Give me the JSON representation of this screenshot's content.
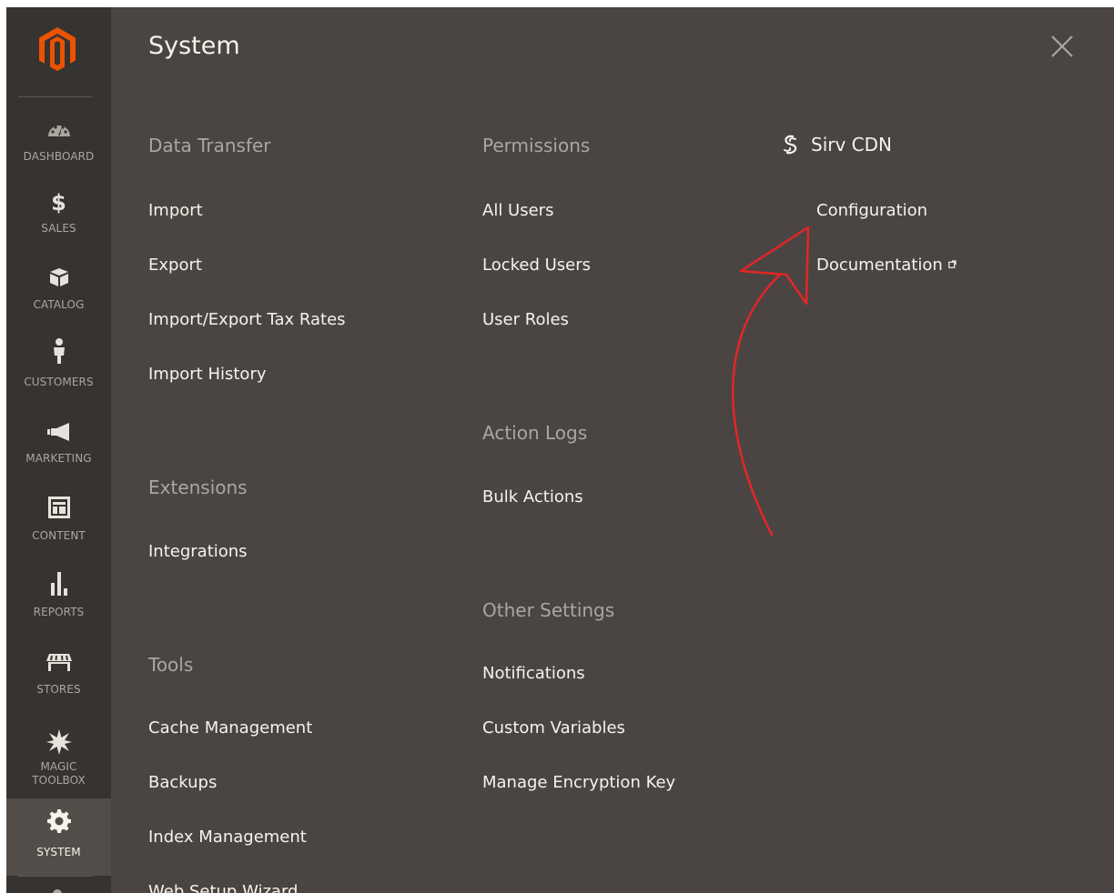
{
  "sidebar": {
    "items": [
      {
        "label": "DASHBOARD",
        "icon": "dashboard-icon"
      },
      {
        "label": "$",
        "icon": "dollar-icon"
      },
      {
        "label": "SALES"
      },
      {
        "label": "CATALOG",
        "icon": "box-icon"
      },
      {
        "label": "CUSTOMERS",
        "icon": "person-icon"
      },
      {
        "label": "MARKETING",
        "icon": "megaphone-icon"
      },
      {
        "label": "CONTENT",
        "icon": "layout-icon"
      },
      {
        "label": "REPORTS",
        "icon": "bar-chart-icon"
      },
      {
        "label": "STORES",
        "icon": "store-icon"
      },
      {
        "label": "MAGIC",
        "icon": "star-burst-icon"
      },
      {
        "label": "TOOLBOX"
      },
      {
        "label": "SYSTEM",
        "icon": "gear-icon"
      }
    ],
    "active": "SYSTEM"
  },
  "panel": {
    "title": "System",
    "columns": {
      "col1": {
        "groups": [
          {
            "title": "Data Transfer",
            "links": [
              "Import",
              "Export",
              "Import/Export Tax Rates",
              "Import History"
            ]
          },
          {
            "title": "Extensions",
            "links": [
              "Integrations"
            ]
          },
          {
            "title": "Tools",
            "links": [
              "Cache Management",
              "Backups",
              "Index Management",
              "Web Setup Wizard"
            ]
          }
        ]
      },
      "col2": {
        "groups": [
          {
            "title": "Permissions",
            "links": [
              "All Users",
              "Locked Users",
              "User Roles"
            ]
          },
          {
            "title": "Action Logs",
            "links": [
              "Bulk Actions"
            ]
          },
          {
            "title": "Other Settings",
            "links": [
              "Notifications",
              "Custom Variables",
              "Manage Encryption Key"
            ]
          }
        ]
      },
      "col3": {
        "groups": [
          {
            "title": "Sirv CDN",
            "icon": "sirv-logo-icon",
            "links": [
              "Configuration",
              "Documentation"
            ]
          }
        ]
      }
    }
  },
  "colors": {
    "sidebar_bg": "#373330",
    "panel_bg": "#4a4542",
    "active_bg": "#524d49",
    "logo_orange": "#eb5202",
    "annotation_red": "#e22626",
    "group_title": "#aaa6a0",
    "link_text": "#f7f3eb"
  }
}
